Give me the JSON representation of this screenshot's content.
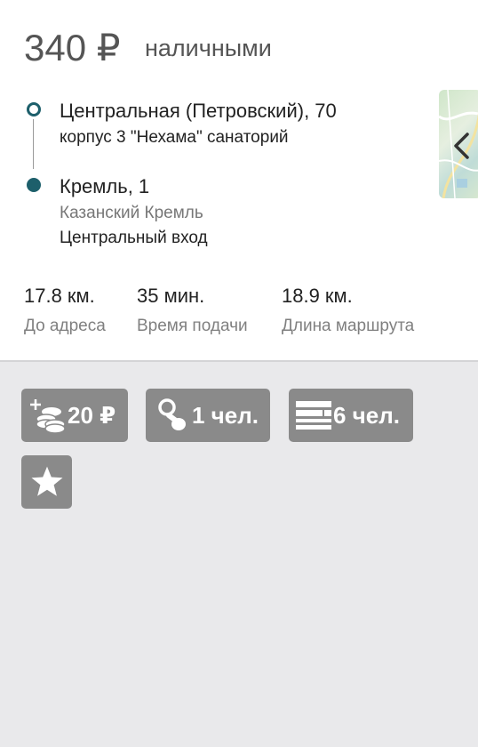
{
  "order": {
    "price": "340 ₽",
    "payment_method": "наличными"
  },
  "route": {
    "from": {
      "address": "Центральная (Петровский), 70",
      "details": "корпус 3 \"Нехама\" санаторий"
    },
    "to": {
      "address": "Кремль, 1",
      "place": "Казанский Кремль",
      "entrance": "Центральный вход"
    }
  },
  "stats": [
    {
      "value": "17.8 км.",
      "label": "До адреса"
    },
    {
      "value": "35 мин.",
      "label": "Время подачи"
    },
    {
      "value": "18.9 км.",
      "label": "Длина маршрута"
    }
  ],
  "options": {
    "surcharge": {
      "label": "20 ₽",
      "icon": "add-coins-icon"
    },
    "child_seat": {
      "label": "1 чел.",
      "icon": "pacifier-icon"
    },
    "passengers": {
      "label": "6 чел.",
      "icon": "seats-icon"
    },
    "favorite": {
      "icon": "star-icon"
    }
  },
  "colors": {
    "route_accent": "#1d5f6b",
    "chip_bg": "#8a8a8a",
    "panel_bg": "#e9e9eb"
  }
}
